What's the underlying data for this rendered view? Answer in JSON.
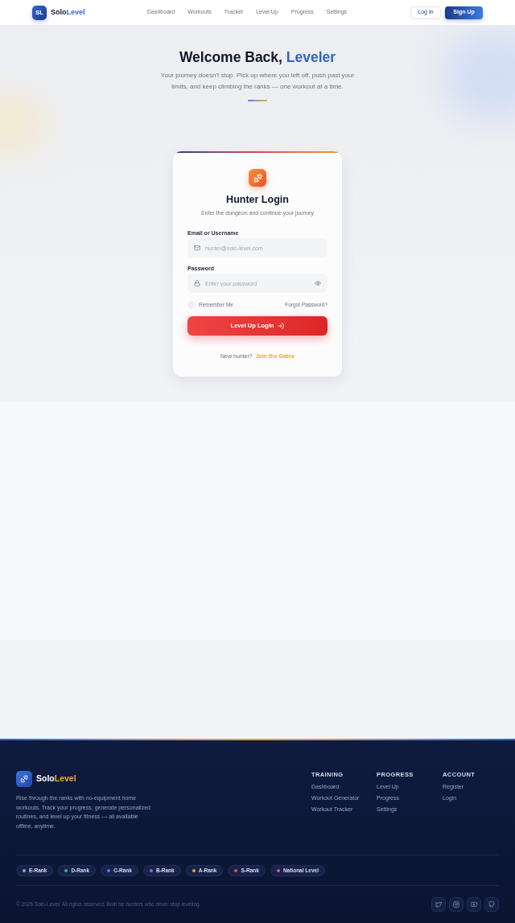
{
  "header": {
    "logo_mark": "SL",
    "brand": {
      "first": "Solo",
      "second": "Level"
    },
    "nav": [
      "Dashboard",
      "Workouts",
      "Tracker",
      "Level Up",
      "Progress",
      "Settings"
    ],
    "login_button": "Log In",
    "signup_button": "Sign Up"
  },
  "hero": {
    "title": "Welcome Back,",
    "title_accent": "Leveler",
    "subtitle": "Your journey doesn't stop. Pick up where you left off, push past your limits, and keep climbing the ranks — one workout at a time."
  },
  "login_card": {
    "title": "Hunter Login",
    "subtitle": "Enter the dungeon and continue your journey",
    "fields": [
      {
        "kind": "email",
        "label": "Email or Username",
        "placeholder": "hunter@solo-level.com"
      },
      {
        "kind": "password",
        "label": "Password",
        "placeholder": "Enter your password"
      }
    ],
    "remember": {
      "label": "Remember Me",
      "checked": false
    },
    "forgot_link": "Forgot Password?",
    "submit_button": "Level Up Login",
    "signup_prompt": "New hunter?",
    "signup_link": "Join the Gates"
  },
  "footer": {
    "brand": {
      "first": "Solo",
      "second": "Level"
    },
    "description": "Rise through the ranks with no-equipment home workouts. Track your progress, generate personalized routines, and level up your fitness — all available offline, anytime.",
    "columns": [
      {
        "heading": "TRAINING",
        "links": [
          "Dashboard",
          "Workout Generator",
          "Workout Tracker"
        ]
      },
      {
        "heading": "PROGRESS",
        "links": [
          "Level Up",
          "Progress",
          "Settings"
        ]
      },
      {
        "heading": "ACCOUNT",
        "links": [
          "Register",
          "Login"
        ]
      }
    ],
    "ranks": [
      {
        "label": "E-Rank",
        "color": "#9ca3af"
      },
      {
        "label": "D-Rank",
        "color": "#22c55e"
      },
      {
        "label": "C-Rank",
        "color": "#3b82f6"
      },
      {
        "label": "B-Rank",
        "color": "#a855f7"
      },
      {
        "label": "A-Rank",
        "color": "#f59e0b"
      },
      {
        "label": "S-Rank",
        "color": "#ef4444"
      },
      {
        "label": "National Level",
        "color": "#ec4899"
      }
    ],
    "copyright": "© 2026 Solo-Level. All rights reserved. Built for hunters who never stop leveling."
  }
}
